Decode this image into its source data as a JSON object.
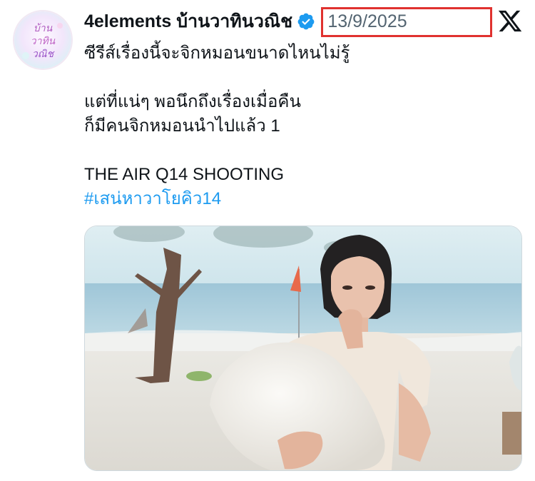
{
  "tweet": {
    "display_name": "4elements บ้านวาทินวณิช",
    "dot": "·",
    "date": "13/9/2025",
    "verified_icon": "verified-badge-icon",
    "platform_icon": "x-logo-icon",
    "highlight_color": "#e0322f",
    "avatar_text": [
      "บ้าน",
      "วาทิน",
      "วณิช"
    ],
    "text_lines": [
      "ซีรีส์เรื่องนี้จะจิกหมอนขนาดไหนไม่รู้",
      "",
      "แต่ที่แน่ๆ พอนึกถึงเรื่องเมื่อคืน",
      "ก็มีคนจิกหมอนนำไปแล้ว 1",
      "",
      "THE AIR Q14 SHOOTING"
    ],
    "hashtag": "#เสน่หาวาโยคิว14",
    "hashtag_color": "#1d9bf0",
    "media": {
      "description": "photo"
    }
  }
}
